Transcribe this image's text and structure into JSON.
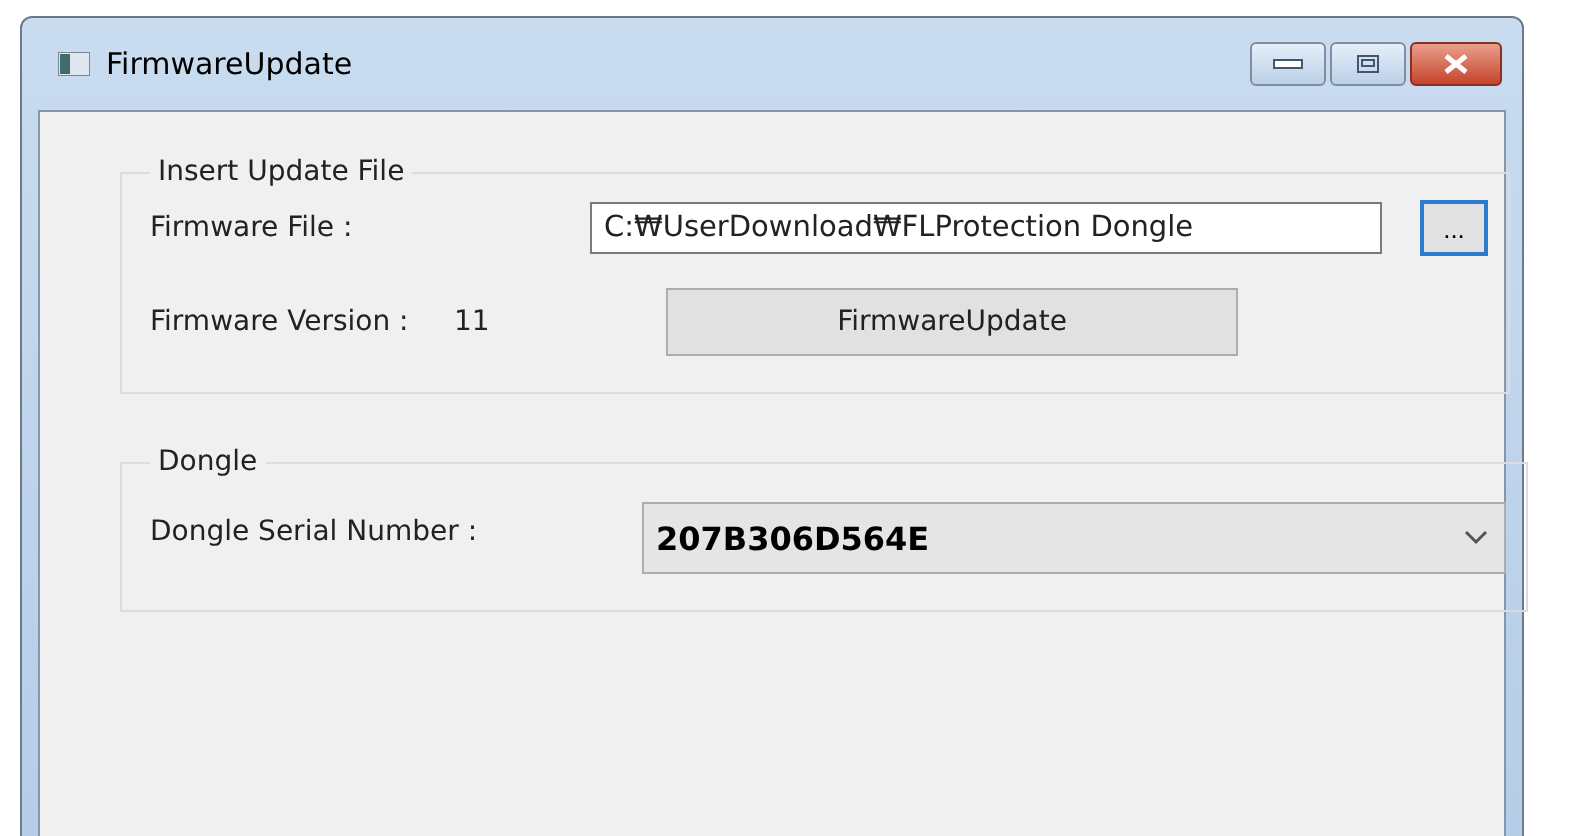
{
  "window": {
    "title": "FirmwareUpdate"
  },
  "update_group": {
    "title": "Insert Update File",
    "file_label": "Firmware File :",
    "file_value": "C:₩UserDownload₩FLProtection Dongle",
    "browse_button": {
      "label": "...",
      "focused": true
    },
    "version_label": "Firmware Version :",
    "version_value": "11",
    "update_button": "FirmwareUpdate"
  },
  "dongle_group": {
    "title": "Dongle",
    "serial_label": "Dongle Serial Number :",
    "serial_value": "207B306D564E"
  }
}
